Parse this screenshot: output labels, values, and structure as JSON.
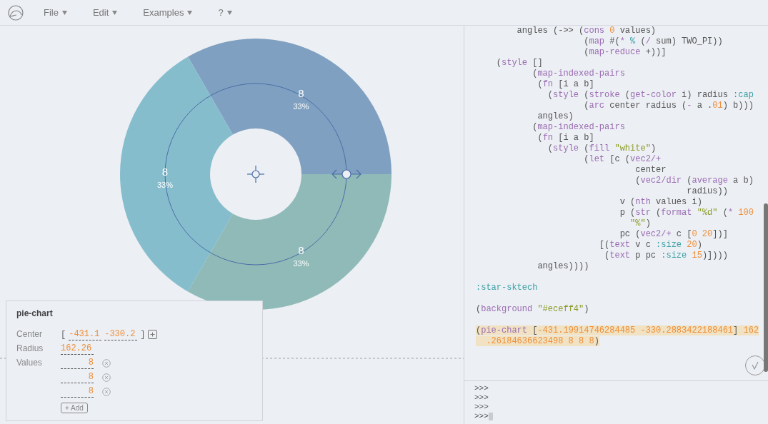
{
  "menu": [
    {
      "label": "File"
    },
    {
      "label": "Edit"
    },
    {
      "label": "Examples"
    },
    {
      "label": "?"
    }
  ],
  "canvas": {
    "chart_data": {
      "type": "donut",
      "series": [
        {
          "values": [
            8,
            8,
            8
          ]
        }
      ],
      "data_labels": true
    },
    "slices": [
      {
        "value": "8",
        "percent": "33%",
        "color": "#7fa0c0"
      },
      {
        "value": "8",
        "percent": "33%",
        "color": "#86bdcc"
      },
      {
        "value": "8",
        "percent": "33%",
        "color": "#8fbab8"
      }
    ]
  },
  "inspector": {
    "title": "pie-chart",
    "brackets": [
      "[",
      "]"
    ],
    "fields": [
      {
        "kind": "vector",
        "label": "Center",
        "values": [
          "-431.1",
          "-330.2"
        ]
      },
      {
        "kind": "number",
        "label": "Radius",
        "value": "162.26"
      },
      {
        "kind": "list",
        "label": "Values",
        "values": [
          "8",
          "8",
          "8"
        ],
        "add_label": "+ Add"
      }
    ]
  },
  "code": {
    "blocks": [
      {
        "highlighted": false,
        "lines": [
          [
            {
              "kind": "plain",
              "text": "        angles (->> ("
            },
            {
              "kind": "fn",
              "text": "cons"
            },
            {
              "kind": "num",
              "text": " 0"
            },
            {
              "kind": "plain",
              "text": " values)"
            }
          ],
          [
            {
              "kind": "plain",
              "text": "                     ("
            },
            {
              "kind": "fn",
              "text": "map"
            },
            {
              "kind": "plain",
              "text": " #("
            },
            {
              "kind": "fn",
              "text": "*"
            },
            {
              "kind": "kw",
              "text": " %"
            },
            {
              "kind": "plain",
              "text": " ("
            },
            {
              "kind": "fn",
              "text": "/"
            },
            {
              "kind": "plain",
              "text": " sum) TWO_PI))"
            }
          ],
          [
            {
              "kind": "plain",
              "text": "                     ("
            },
            {
              "kind": "fn",
              "text": "map-reduce"
            },
            {
              "kind": "plain",
              "text": " +))]"
            }
          ],
          [
            {
              "kind": "plain",
              "text": "    ("
            },
            {
              "kind": "fn",
              "text": "style"
            },
            {
              "kind": "plain",
              "text": " []"
            }
          ],
          [
            {
              "kind": "plain",
              "text": "           ("
            },
            {
              "kind": "fn",
              "text": "map-indexed-pairs"
            }
          ],
          [
            {
              "kind": "plain",
              "text": "            ("
            },
            {
              "kind": "fn",
              "text": "fn"
            },
            {
              "kind": "plain",
              "text": " [i a b]"
            }
          ],
          [
            {
              "kind": "plain",
              "text": "              ("
            },
            {
              "kind": "fn",
              "text": "style"
            },
            {
              "kind": "plain",
              "text": " ("
            },
            {
              "kind": "fn",
              "text": "stroke"
            },
            {
              "kind": "plain",
              "text": " ("
            },
            {
              "kind": "fn",
              "text": "get-color"
            },
            {
              "kind": "plain",
              "text": " i) radius "
            },
            {
              "kind": "kw",
              "text": ":cap"
            }
          ],
          [
            {
              "kind": "plain",
              "text": "                     ("
            },
            {
              "kind": "fn",
              "text": "arc"
            },
            {
              "kind": "plain",
              "text": " center radius ("
            },
            {
              "kind": "fn",
              "text": "-"
            },
            {
              "kind": "plain",
              "text": " a ."
            },
            {
              "kind": "num",
              "text": "01"
            },
            {
              "kind": "plain",
              "text": ") b)))"
            }
          ],
          [
            {
              "kind": "plain",
              "text": "            angles)"
            }
          ],
          [
            {
              "kind": "plain",
              "text": "           ("
            },
            {
              "kind": "fn",
              "text": "map-indexed-pairs"
            }
          ],
          [
            {
              "kind": "plain",
              "text": "            ("
            },
            {
              "kind": "fn",
              "text": "fn"
            },
            {
              "kind": "plain",
              "text": " [i a b]"
            }
          ],
          [
            {
              "kind": "plain",
              "text": "              ("
            },
            {
              "kind": "fn",
              "text": "style"
            },
            {
              "kind": "plain",
              "text": " ("
            },
            {
              "kind": "fn",
              "text": "fill"
            },
            {
              "kind": "str",
              "text": " \"white\""
            },
            {
              "kind": "plain",
              "text": ")"
            }
          ],
          [
            {
              "kind": "plain",
              "text": "                     ("
            },
            {
              "kind": "fn",
              "text": "let"
            },
            {
              "kind": "plain",
              "text": " [c ("
            },
            {
              "kind": "fn",
              "text": "vec2/+"
            }
          ],
          [
            {
              "kind": "plain",
              "text": "                               center"
            }
          ],
          [
            {
              "kind": "plain",
              "text": "                               ("
            },
            {
              "kind": "fn",
              "text": "vec2/dir"
            },
            {
              "kind": "plain",
              "text": " ("
            },
            {
              "kind": "fn",
              "text": "average"
            },
            {
              "kind": "plain",
              "text": " a b)"
            }
          ],
          [
            {
              "kind": "plain",
              "text": "                                         radius))"
            }
          ],
          [
            {
              "kind": "plain",
              "text": "                            v ("
            },
            {
              "kind": "fn",
              "text": "nth"
            },
            {
              "kind": "plain",
              "text": " values i)"
            }
          ],
          [
            {
              "kind": "plain",
              "text": "                            p ("
            },
            {
              "kind": "fn",
              "text": "str"
            },
            {
              "kind": "plain",
              "text": " ("
            },
            {
              "kind": "fn",
              "text": "format"
            },
            {
              "kind": "str",
              "text": " \"%d\""
            },
            {
              "kind": "plain",
              "text": " ("
            },
            {
              "kind": "fn",
              "text": "*"
            },
            {
              "kind": "num",
              "text": " 100"
            }
          ],
          [
            {
              "kind": "str",
              "text": "                              \"%\""
            },
            {
              "kind": "plain",
              "text": ")"
            }
          ],
          [
            {
              "kind": "plain",
              "text": "                            pc ("
            },
            {
              "kind": "fn",
              "text": "vec2/+"
            },
            {
              "kind": "plain",
              "text": " c ["
            },
            {
              "kind": "num",
              "text": "0 20"
            },
            {
              "kind": "plain",
              "text": "])]"
            }
          ],
          [
            {
              "kind": "plain",
              "text": "                        [("
            },
            {
              "kind": "fn",
              "text": "text"
            },
            {
              "kind": "plain",
              "text": " v c "
            },
            {
              "kind": "kw",
              "text": ":size"
            },
            {
              "kind": "num",
              "text": " 20"
            },
            {
              "kind": "plain",
              "text": ")"
            }
          ],
          [
            {
              "kind": "plain",
              "text": "                         ("
            },
            {
              "kind": "fn",
              "text": "text"
            },
            {
              "kind": "plain",
              "text": " p pc "
            },
            {
              "kind": "kw",
              "text": ":size"
            },
            {
              "kind": "num",
              "text": " 15"
            },
            {
              "kind": "plain",
              "text": ")])))"
            }
          ],
          [
            {
              "kind": "plain",
              "text": "            angles))))"
            }
          ]
        ]
      },
      {
        "highlighted": false,
        "lines": [
          [
            {
              "kind": "kw",
              "text": ":star-sktech"
            }
          ]
        ]
      },
      {
        "highlighted": false,
        "lines": [
          [
            {
              "kind": "plain",
              "text": "("
            },
            {
              "kind": "fn",
              "text": "background"
            },
            {
              "kind": "str",
              "text": " \"#eceff4\""
            },
            {
              "kind": "plain",
              "text": ")"
            }
          ]
        ]
      },
      {
        "highlighted": true,
        "lines": [
          [
            {
              "kind": "plain",
              "text": "("
            },
            {
              "kind": "fn",
              "text": "pie-chart"
            },
            {
              "kind": "plain",
              "text": " ["
            },
            {
              "kind": "num",
              "text": "-431.19914746284485 -330.2883422188461"
            },
            {
              "kind": "plain",
              "text": "]"
            },
            {
              "kind": "num",
              "text": " 162"
            }
          ],
          [
            {
              "kind": "num",
              "text": "  .26184636623498 8 8 8"
            },
            {
              "kind": "plain",
              "text": ")"
            }
          ]
        ]
      }
    ]
  },
  "repl": {
    "prompts": [
      ">>>",
      ">>>",
      ">>>",
      ">>>"
    ]
  }
}
